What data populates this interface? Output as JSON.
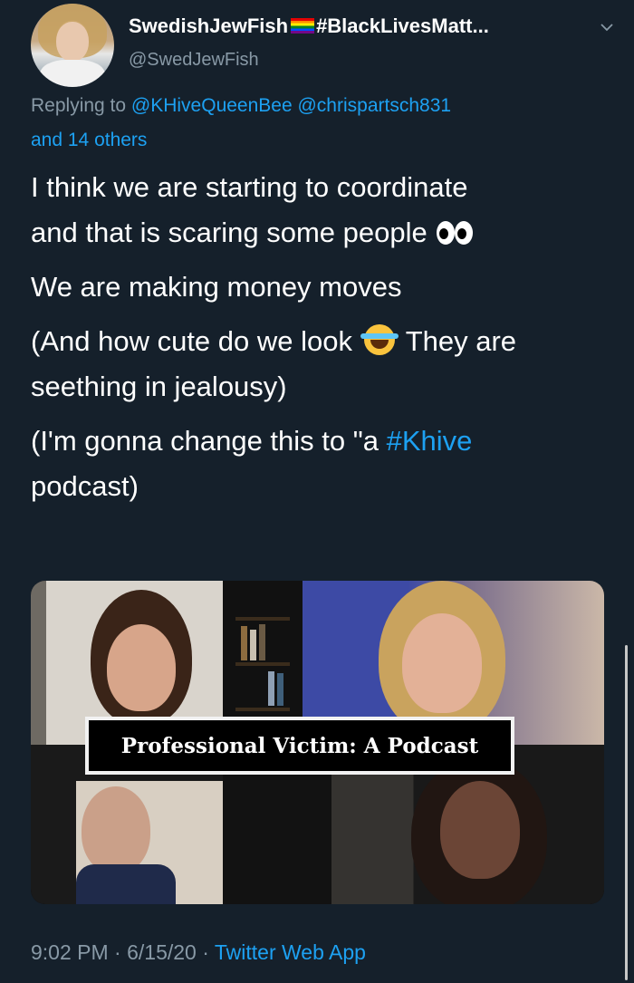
{
  "author": {
    "display_name_pre": "SwedishJewFish",
    "display_name_post": "#BlackLivesMatt...",
    "handle": "@SwedJewFish"
  },
  "reply": {
    "prefix": "Replying to ",
    "mentions": "@KHiveQueenBee @chrispartsch831",
    "others": "and 14 others"
  },
  "body": {
    "line1": "I think we are starting to coordinate",
    "line2": "and that is scaring some people",
    "line3": "We are making money moves",
    "line4a": "(And how cute do we look",
    "line4b": "They are",
    "line5": "seething in jealousy)",
    "line6a": "(I'm gonna change this to \"a",
    "line6_hashtag": "#Khive",
    "line7": "podcast)"
  },
  "media": {
    "caption": "Professional Victim: A Podcast"
  },
  "footer": {
    "time": "9:02 PM",
    "sep1": " · ",
    "date": "6/15/20",
    "sep2": " · ",
    "source": "Twitter Web App"
  },
  "colors": {
    "background": "#15202b",
    "link": "#1da1f2",
    "muted": "#8899a6",
    "text": "#ffffff"
  },
  "icons": [
    "rainbow-flag-icon",
    "chevron-down-icon",
    "eyes-emoji-icon",
    "laughing-tears-emoji-icon"
  ]
}
